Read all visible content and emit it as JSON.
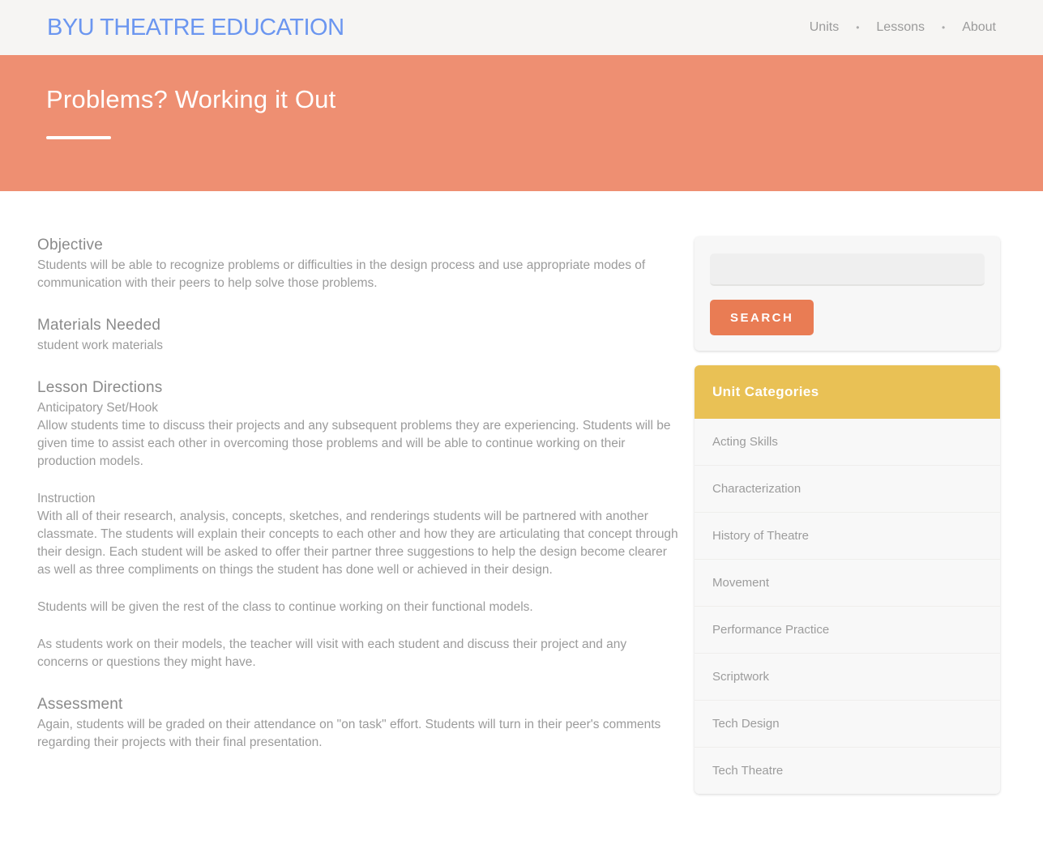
{
  "header": {
    "logo": "BYU THEATRE EDUCATION",
    "nav_separator": "•",
    "nav": [
      {
        "label": "Units"
      },
      {
        "label": "Lessons"
      },
      {
        "label": "About"
      }
    ]
  },
  "hero": {
    "title": "Problems? Working it Out"
  },
  "article": {
    "sections": [
      {
        "heading": "Objective",
        "text": "Students will be able to recognize problems or difficulties in the design process and use appropriate modes of communication with their peers to help solve those problems."
      },
      {
        "heading": "Materials Needed",
        "text": "student work materials"
      },
      {
        "heading": "Lesson Directions",
        "blocks": [
          {
            "label": "Anticipatory Set/Hook",
            "text": "Allow students time to discuss their projects and any subsequent problems they are experiencing. Students will be given time to assist each other in overcoming those problems and will be able to continue working on their production models."
          },
          {
            "label": "Instruction",
            "text": "With all of their research, analysis, concepts, sketches, and renderings students will be partnered with another classmate. The students will explain their concepts to each other and how they are articulating that concept through their design. Each student will be asked to offer their partner three suggestions to help the design become clearer as well as three compliments on things the student has done well or achieved in their design."
          },
          {
            "text": "Students will be given the rest of the class to continue working on their functional models."
          },
          {
            "text": "As students work on their models, the teacher will visit with each student and discuss their project and any concerns or questions they might have."
          }
        ]
      },
      {
        "heading": "Assessment",
        "text": "Again, students will be graded on their attendance on \"on task\" effort. Students will turn in their peer's comments regarding their projects with their final presentation."
      }
    ]
  },
  "sidebar": {
    "search": {
      "input_value": "",
      "button_label": "SEARCH"
    },
    "categories": {
      "title": "Unit Categories",
      "items": [
        {
          "label": "Acting Skills"
        },
        {
          "label": "Characterization"
        },
        {
          "label": "History of Theatre"
        },
        {
          "label": "Movement"
        },
        {
          "label": "Performance Practice"
        },
        {
          "label": "Scriptwork"
        },
        {
          "label": "Tech Design"
        },
        {
          "label": "Tech Theatre"
        }
      ]
    }
  },
  "colors": {
    "hero_background": "#EE8F72",
    "search_button": "#E97C54",
    "categories_header": "#E9C155",
    "logo_blue": "#6B96F0",
    "header_background": "#F6F5F3"
  }
}
